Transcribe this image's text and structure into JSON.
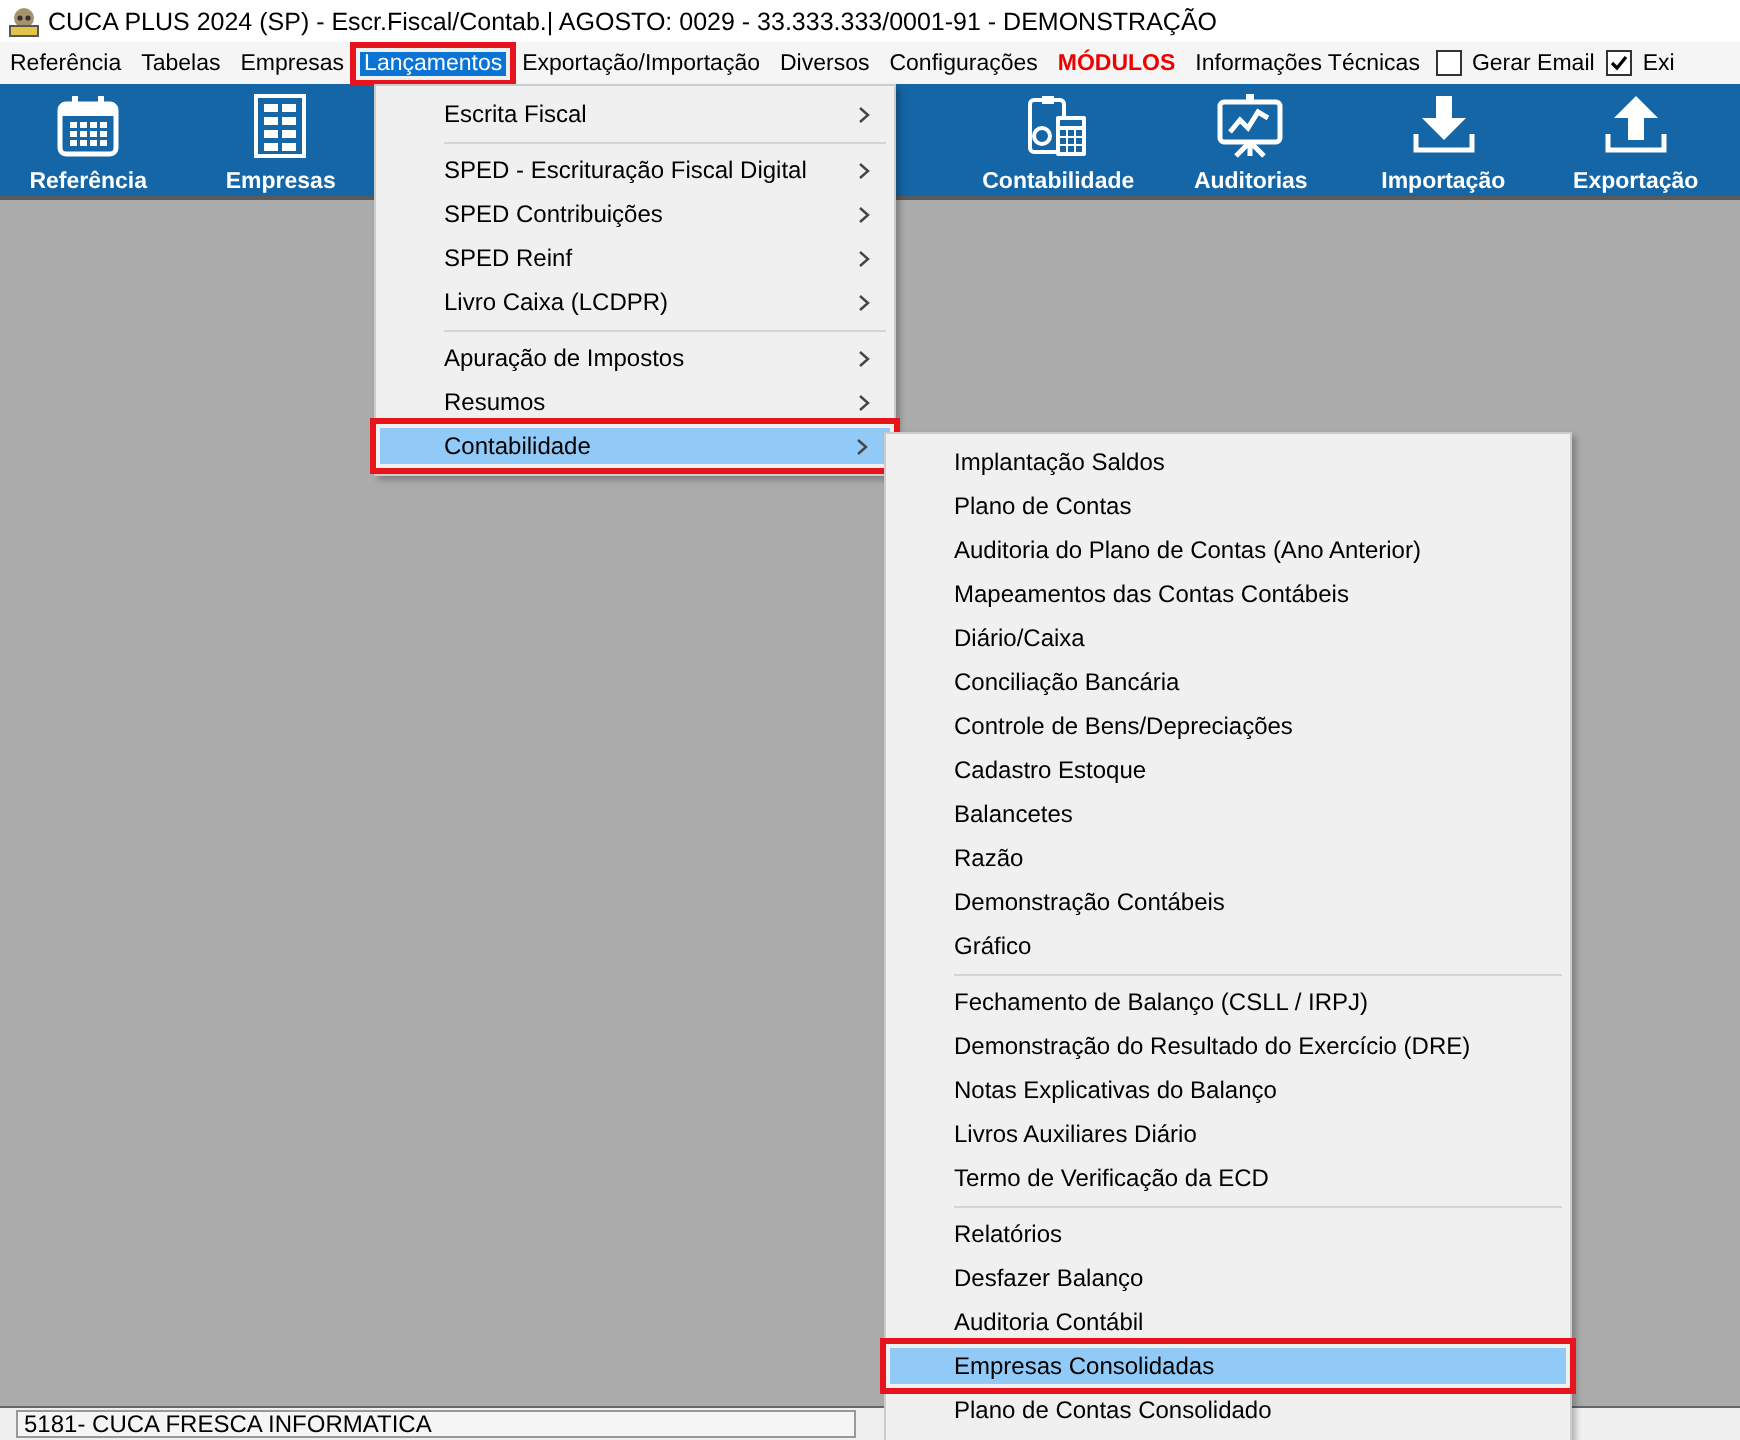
{
  "window": {
    "title": "CUCA PLUS 2024 (SP) - Escr.Fiscal/Contab.| AGOSTO: 0029 - 33.333.333/0001-91 - DEMONSTRAÇÃO"
  },
  "menubar": [
    {
      "label": "Referência",
      "selected": false,
      "annotated": false
    },
    {
      "label": "Tabelas",
      "selected": false,
      "annotated": false
    },
    {
      "label": "Empresas",
      "selected": false,
      "annotated": false
    },
    {
      "label": "Lançamentos",
      "selected": true,
      "annotated": true
    },
    {
      "label": "Exportação/Importação",
      "selected": false,
      "annotated": false
    },
    {
      "label": "Diversos",
      "selected": false,
      "annotated": false
    },
    {
      "label": "Configurações",
      "selected": false,
      "annotated": false
    },
    {
      "label": "MÓDULOS",
      "kind": "accent",
      "selected": false,
      "annotated": false
    },
    {
      "label": "Informações Técnicas",
      "selected": false,
      "annotated": false
    },
    {
      "label": "Gerar Email",
      "kind": "checkbox",
      "checked": false
    },
    {
      "label": "Exi",
      "kind": "checkbox",
      "checked": true
    }
  ],
  "toolbar": [
    {
      "label": "Referência",
      "kind": "calendar"
    },
    {
      "label": "Empresas",
      "kind": "building"
    },
    {
      "label": "Contabilidade",
      "kind": "calculator"
    },
    {
      "label": "Auditorias",
      "kind": "chart"
    },
    {
      "label": "Importação",
      "kind": "download"
    },
    {
      "label": "Exportação",
      "kind": "upload"
    }
  ],
  "menu": {
    "groups": [
      [
        {
          "label": "Escrita Fiscal",
          "selected": false,
          "annotated": false
        }
      ],
      [
        {
          "label": "SPED - Escrituração Fiscal Digital",
          "selected": false,
          "annotated": false
        },
        {
          "label": "SPED Contribuições",
          "selected": false,
          "annotated": false
        },
        {
          "label": "SPED Reinf",
          "selected": false,
          "annotated": false
        },
        {
          "label": "Livro Caixa (LCDPR)",
          "selected": false,
          "annotated": false
        }
      ],
      [
        {
          "label": "Apuração de Impostos",
          "selected": false,
          "annotated": false
        },
        {
          "label": "Resumos",
          "selected": false,
          "annotated": false
        },
        {
          "label": "Contabilidade",
          "selected": true,
          "annotated": true
        }
      ]
    ]
  },
  "submenu": {
    "groups": [
      [
        {
          "label": "Implantação Saldos",
          "selected": false,
          "annotated": false
        },
        {
          "label": "Plano de Contas",
          "selected": false,
          "annotated": false
        },
        {
          "label": "Auditoria do Plano de Contas (Ano Anterior)",
          "selected": false,
          "annotated": false
        },
        {
          "label": "Mapeamentos das Contas Contábeis",
          "selected": false,
          "annotated": false
        },
        {
          "label": "Diário/Caixa",
          "selected": false,
          "annotated": false
        },
        {
          "label": "Conciliação Bancária",
          "selected": false,
          "annotated": false
        },
        {
          "label": "Controle de Bens/Depreciações",
          "selected": false,
          "annotated": false
        },
        {
          "label": "Cadastro Estoque",
          "selected": false,
          "annotated": false
        },
        {
          "label": "Balancetes",
          "selected": false,
          "annotated": false
        },
        {
          "label": "Razão",
          "selected": false,
          "annotated": false
        },
        {
          "label": "Demonstração Contábeis",
          "selected": false,
          "annotated": false
        },
        {
          "label": "Gráfico",
          "selected": false,
          "annotated": false
        }
      ],
      [
        {
          "label": "Fechamento de Balanço (CSLL / IRPJ)",
          "selected": false,
          "annotated": false
        },
        {
          "label": "Demonstração do Resultado do Exercício (DRE)",
          "selected": false,
          "annotated": false
        },
        {
          "label": "Notas Explicativas do Balanço",
          "selected": false,
          "annotated": false
        },
        {
          "label": "Livros Auxiliares Diário",
          "selected": false,
          "annotated": false
        },
        {
          "label": "Termo de Verificação da ECD",
          "selected": false,
          "annotated": false
        }
      ],
      [
        {
          "label": "Relatórios",
          "selected": false,
          "annotated": false
        },
        {
          "label": "Desfazer Balanço",
          "selected": false,
          "annotated": false
        },
        {
          "label": "Auditoria Contábil",
          "selected": false,
          "annotated": false
        },
        {
          "label": "Empresas Consolidadas",
          "selected": true,
          "annotated": true
        },
        {
          "label": "Plano de Contas Consolidado",
          "selected": false,
          "annotated": false
        }
      ]
    ]
  },
  "status_bar": {
    "text": "5181- CUCA FRESCA INFORMATICA"
  }
}
